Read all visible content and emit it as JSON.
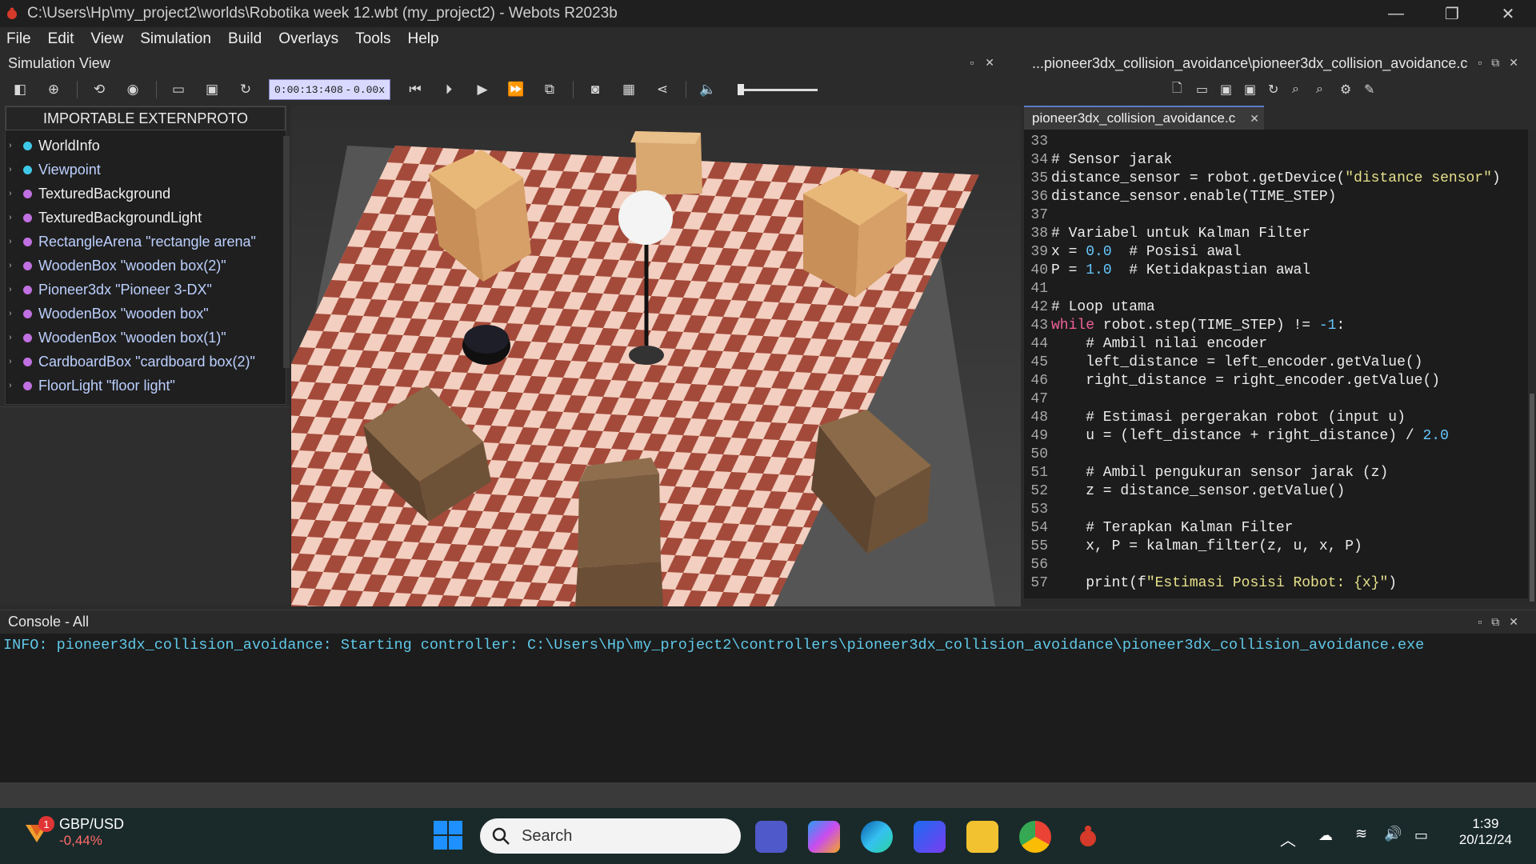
{
  "window": {
    "title": "C:\\Users\\Hp\\my_project2\\worlds\\Robotika week 12.wbt (my_project2) - Webots R2023b",
    "controls": [
      "—",
      "❐",
      "✕"
    ]
  },
  "menu": [
    "File",
    "Edit",
    "View",
    "Simulation",
    "Build",
    "Overlays",
    "Tools",
    "Help"
  ],
  "simulation_view": {
    "title": "Simulation View",
    "time": "0:00:13:408",
    "speed": "0.00x"
  },
  "scene_tree": {
    "proto_button": "IMPORTABLE EXTERNPROTO",
    "items": [
      {
        "label": "WorldInfo",
        "color": "#3ec8e8",
        "text_color": "#f0f0f0"
      },
      {
        "label": "Viewpoint",
        "color": "#3ec8e8",
        "text_color": "#bcd0ff"
      },
      {
        "label": "TexturedBackground",
        "color": "#c070e0",
        "text_color": "#f0f0f0"
      },
      {
        "label": "TexturedBackgroundLight",
        "color": "#c070e0",
        "text_color": "#f0f0f0"
      },
      {
        "label": "RectangleArena \"rectangle arena\"",
        "color": "#c070e0",
        "text_color": "#bcd0ff"
      },
      {
        "label": "WoodenBox \"wooden box(2)\"",
        "color": "#c070e0",
        "text_color": "#bcd0ff"
      },
      {
        "label": "Pioneer3dx \"Pioneer 3-DX\"",
        "color": "#c070e0",
        "text_color": "#bcd0ff"
      },
      {
        "label": "WoodenBox \"wooden box\"",
        "color": "#c070e0",
        "text_color": "#bcd0ff"
      },
      {
        "label": "WoodenBox \"wooden box(1)\"",
        "color": "#c070e0",
        "text_color": "#bcd0ff"
      },
      {
        "label": "CardboardBox \"cardboard box(2)\"",
        "color": "#c070e0",
        "text_color": "#bcd0ff"
      },
      {
        "label": "FloorLight \"floor light\"",
        "color": "#c070e0",
        "text_color": "#bcd0ff"
      }
    ]
  },
  "editor": {
    "title": "...pioneer3dx_collision_avoidance\\pioneer3dx_collision_avoidance.c",
    "tab": "pioneer3dx_collision_avoidance.c",
    "lines": [
      {
        "n": "33",
        "t": ""
      },
      {
        "n": "34",
        "t": "# Sensor jarak"
      },
      {
        "n": "35",
        "t": "distance_sensor = robot.getDevice(\"distance sensor\")"
      },
      {
        "n": "36",
        "t": "distance_sensor.enable(TIME_STEP)"
      },
      {
        "n": "37",
        "t": ""
      },
      {
        "n": "38",
        "t": "# Variabel untuk Kalman Filter"
      },
      {
        "n": "39",
        "t": "x = 0.0  # Posisi awal"
      },
      {
        "n": "40",
        "t": "P = 1.0  # Ketidakpastian awal"
      },
      {
        "n": "41",
        "t": ""
      },
      {
        "n": "42",
        "t": "# Loop utama"
      },
      {
        "n": "43",
        "t": "while robot.step(TIME_STEP) != -1:"
      },
      {
        "n": "44",
        "t": "    # Ambil nilai encoder"
      },
      {
        "n": "45",
        "t": "    left_distance = left_encoder.getValue()"
      },
      {
        "n": "46",
        "t": "    right_distance = right_encoder.getValue()"
      },
      {
        "n": "47",
        "t": ""
      },
      {
        "n": "48",
        "t": "    # Estimasi pergerakan robot (input u)"
      },
      {
        "n": "49",
        "t": "    u = (left_distance + right_distance) / 2.0"
      },
      {
        "n": "50",
        "t": ""
      },
      {
        "n": "51",
        "t": "    # Ambil pengukuran sensor jarak (z)"
      },
      {
        "n": "52",
        "t": "    z = distance_sensor.getValue()"
      },
      {
        "n": "53",
        "t": ""
      },
      {
        "n": "54",
        "t": "    # Terapkan Kalman Filter"
      },
      {
        "n": "55",
        "t": "    x, P = kalman_filter(z, u, x, P)"
      },
      {
        "n": "56",
        "t": ""
      },
      {
        "n": "57",
        "t": "    print(f\"Estimasi Posisi Robot: {x}\")"
      }
    ]
  },
  "console": {
    "title": "Console - All",
    "text": "INFO: pioneer3dx_collision_avoidance: Starting controller: C:\\Users\\Hp\\my_project2\\controllers\\pioneer3dx_collision_avoidance\\pioneer3dx_collision_avoidance.exe"
  },
  "taskbar": {
    "widget_ticker": "GBP/USD",
    "widget_change": "-0,44%",
    "widget_badge": "1",
    "search_placeholder": "Search",
    "time": "1:39",
    "date": "20/12/24"
  }
}
